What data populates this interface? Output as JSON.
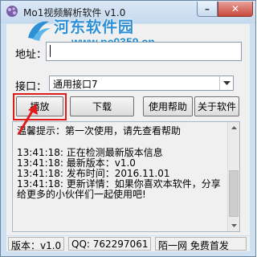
{
  "window": {
    "title": "Mo1视频解析软件 v1.0",
    "minimize_glyph": "–",
    "close_glyph": "✕"
  },
  "watermark": {
    "name": "河东软件园",
    "url": "www.pc0359.cn"
  },
  "address": {
    "label": "地址：",
    "value": ""
  },
  "interface": {
    "label": "接口：",
    "selected": "通用接口7"
  },
  "buttons": {
    "play": "播放",
    "download": "下载",
    "help": "使用帮助",
    "about": "关于软件"
  },
  "log": {
    "tip": "温馨提示：第一次使用，请先查看帮助",
    "lines": [
      "13:41:18:   正在检测最新版本信息",
      "13:41:18:   最新版本：v1.0",
      "13:41:18:   发布时间：2016.11.01",
      "13:41:18:   更新详情：如果你喜欢本软件，分享给更多的小伙伴们一起使用吧!"
    ]
  },
  "status": {
    "version": "版本：v1.0",
    "qq": "QQ: 762297061",
    "publisher": "陌一网 免费首发"
  },
  "colors": {
    "highlight": "#e01b1b",
    "watermark": "#2d8fd5"
  },
  "icons": [
    "app-icon",
    "dropdown-arrow-icon",
    "scroll-up-icon",
    "scroll-down-icon",
    "pointer-arrow-icon"
  ]
}
